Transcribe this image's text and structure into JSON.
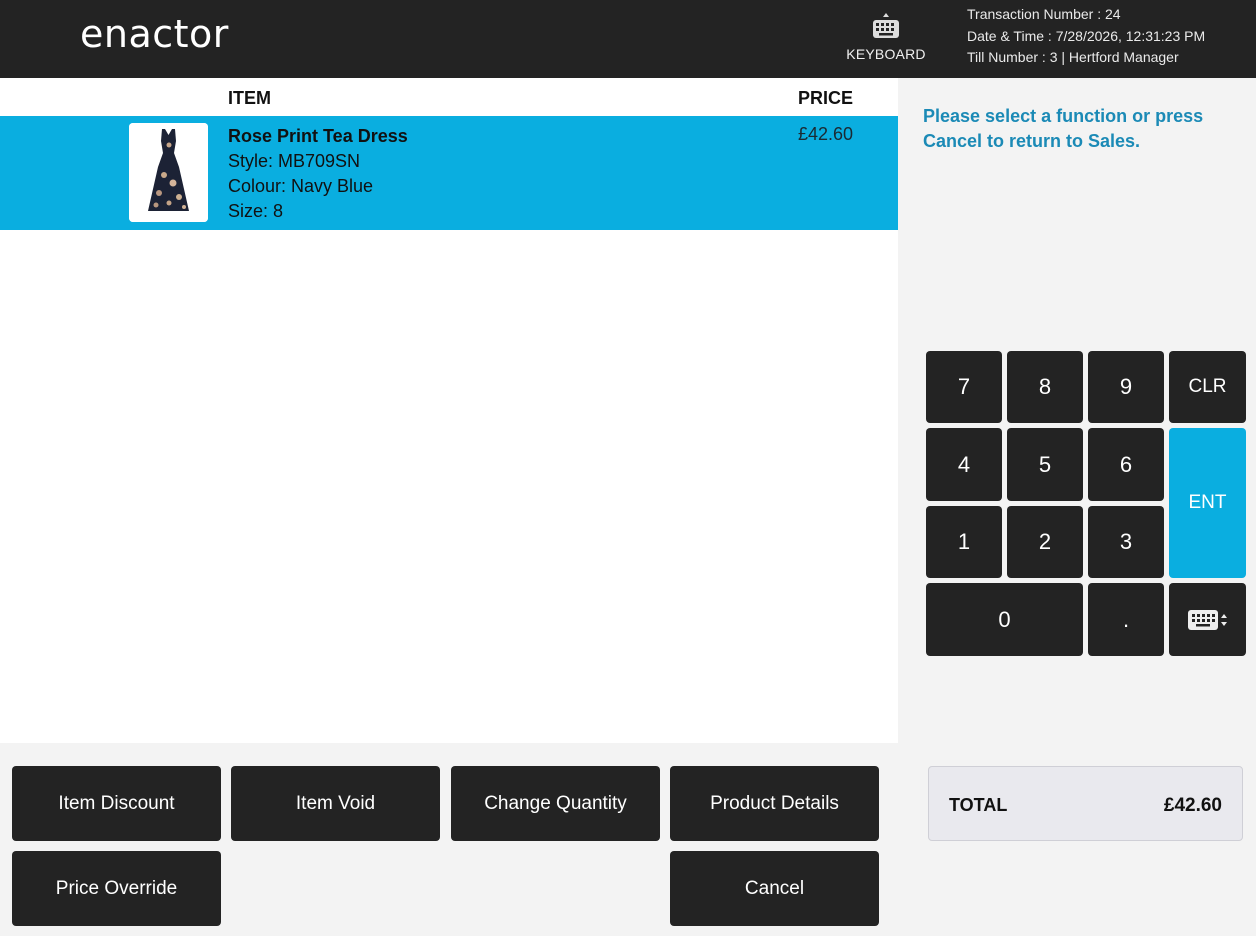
{
  "header": {
    "logo_text": "enactor",
    "keyboard_label": "KEYBOARD",
    "transaction": "Transaction Number : 24",
    "datetime": "Date & Time : 7/28/2026, 12:31:23 PM",
    "till": "Till Number : 3  |  Hertford Manager"
  },
  "basket": {
    "col_item": "ITEM",
    "col_price": "PRICE",
    "lines": [
      {
        "name": "Rose Print Tea Dress",
        "style": "Style: MB709SN",
        "colour": "Colour: Navy Blue",
        "size": "Size: 8",
        "price": "£42.60"
      }
    ]
  },
  "prompt": "Please select a function or press Cancel to return to Sales.",
  "keypad": {
    "k7": "7",
    "k8": "8",
    "k9": "9",
    "clr": "CLR",
    "k4": "4",
    "k5": "5",
    "k6": "6",
    "ent": "ENT",
    "k1": "1",
    "k2": "2",
    "k3": "3",
    "k0": "0",
    "dot": "."
  },
  "total": {
    "label": "TOTAL",
    "value": "£42.60"
  },
  "functions": {
    "item_discount": "Item Discount",
    "item_void": "Item Void",
    "change_quantity": "Change Quantity",
    "product_details": "Product Details",
    "price_override": "Price Override",
    "cancel": "Cancel"
  },
  "colors": {
    "header_bg": "#232323",
    "accent": "#0aaee0",
    "prompt_text": "#1b8ab6",
    "button_bg": "#232323"
  }
}
